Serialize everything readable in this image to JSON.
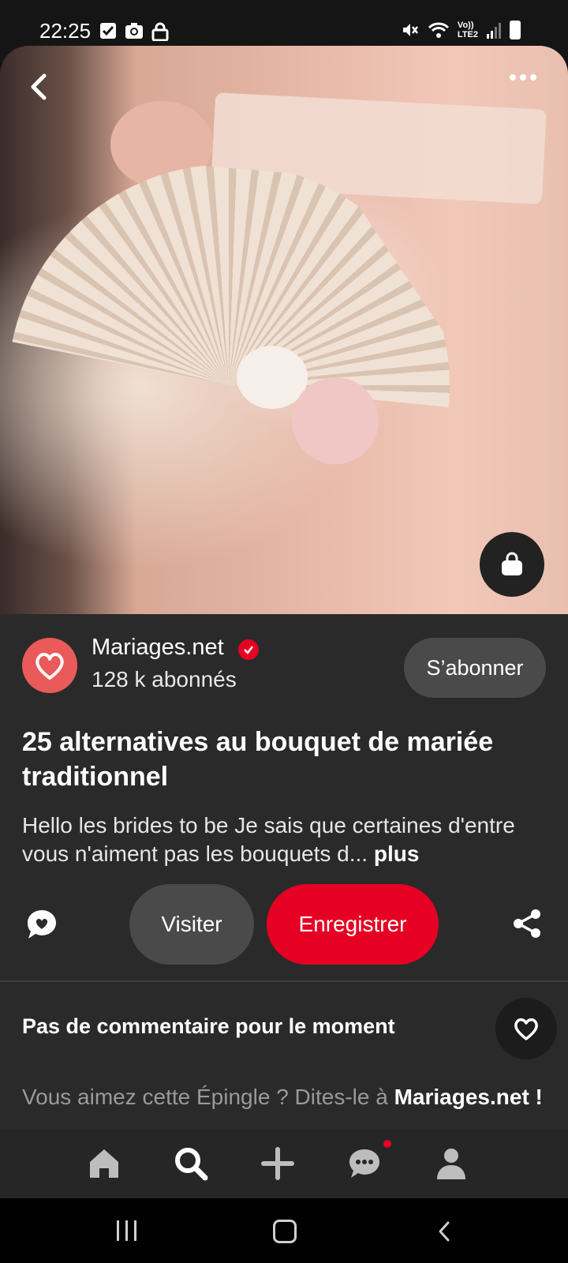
{
  "status_bar": {
    "time": "22:25",
    "left_icons": [
      "check-box-icon",
      "camera-icon",
      "lock-icon"
    ],
    "right_icons": [
      "mute-icon",
      "wifi-icon",
      "lte-icon",
      "signal-icon",
      "battery-icon"
    ],
    "network_label_top": "Vo))",
    "network_label_bottom": "LTE2"
  },
  "pin": {
    "image_alt": "Bride holding a lace fan with a rose bouquet",
    "creator": {
      "name": "Mariages.net",
      "followers": "128 k abonnés",
      "follow_label": "S’abonner",
      "avatar_color": "#ea5a5a"
    },
    "title": "25 alternatives au bouquet de mariée traditionnel",
    "description": "Hello les brides to be Je sais que certaines d'entre vous n'aiment pas les bouquets d...",
    "more_label": "plus",
    "actions": {
      "visit_label": "Visiter",
      "save_label": "Enregistrer"
    },
    "comments": {
      "empty_label": "Pas de commentaire pour le moment",
      "prompt_text": "Vous aimez cette Épingle ? Dites-le à ",
      "prompt_target": "Mariages.net !"
    }
  },
  "bottom_nav": {
    "items": [
      "home-icon",
      "search-icon",
      "plus-icon",
      "chat-icon",
      "profile-icon"
    ],
    "active": "search-icon"
  },
  "colors": {
    "accent": "#e60023",
    "panel": "#2a2a2a",
    "secondary_button": "#4a4a4a"
  }
}
